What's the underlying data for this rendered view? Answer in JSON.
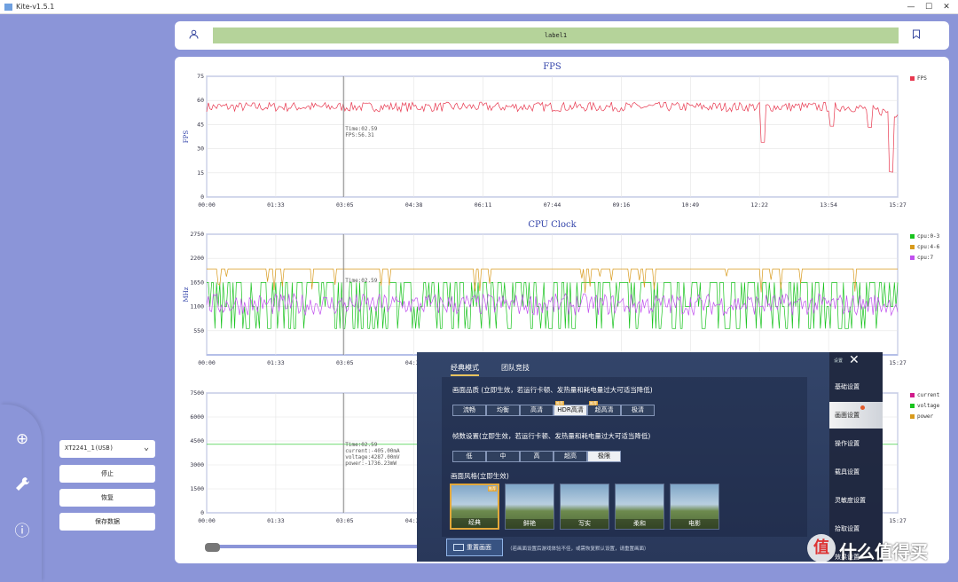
{
  "window": {
    "title": "Kite-v1.5.1",
    "controls": [
      "—",
      "☐",
      "✕"
    ]
  },
  "header": {
    "label": "label1"
  },
  "device": {
    "selected": "XT2241_1(USB)",
    "buttons": [
      "停止",
      "恢复",
      "保存数据"
    ]
  },
  "chart_data": [
    {
      "type": "line",
      "title": "FPS",
      "ylabel": "FPS",
      "yticks": [
        "0",
        "15",
        "30",
        "45",
        "60",
        "75"
      ],
      "ylim": [
        0,
        75
      ],
      "xticks": [
        "00:00",
        "01:33",
        "03:05",
        "04:38",
        "06:11",
        "07:44",
        "09:16",
        "10:49",
        "12:22",
        "13:54",
        "15:27"
      ],
      "series": [
        {
          "name": "FPS",
          "color": "#e8384f",
          "base": 56,
          "noise": 3,
          "dips": [
            [
              0.805,
              34
            ],
            [
              0.99,
              19
            ],
            [
              0.905,
              44
            ],
            [
              0.96,
              45
            ]
          ]
        }
      ],
      "cursor": {
        "time_frac": 0.2,
        "text": [
          "Time:02.59",
          "FPS:56.31"
        ]
      },
      "legend": "right"
    },
    {
      "type": "line",
      "title": "CPU Clock",
      "ylabel": "MHz",
      "yticks": [
        "550",
        "1100",
        "1650",
        "2200",
        "2750"
      ],
      "ylim": [
        0,
        2750
      ],
      "xticks": [
        "00:00",
        "01:33",
        "03:05",
        "04:38",
        "06:11",
        "07:44",
        "09:16",
        "10:49",
        "12:22",
        "13:54",
        "15:27"
      ],
      "series": [
        {
          "name": "cpu:0-3",
          "color": "#19c31e",
          "base": 1100,
          "noise": 500
        },
        {
          "name": "cpu:4-6",
          "color": "#d89a1c",
          "base": 1960,
          "noise": 40
        },
        {
          "name": "cpu:7",
          "color": "#c050ee",
          "base": 1100,
          "noise": 250
        }
      ],
      "cursor": {
        "time_frac": 0.2,
        "text": [
          "Time:02.59"
        ]
      },
      "legend": "right"
    },
    {
      "type": "line",
      "title": "",
      "ylabel": "",
      "yticks": [
        "0",
        "1500",
        "3000",
        "4500",
        "6000",
        "7500"
      ],
      "ylim": [
        0,
        7500
      ],
      "xticks": [
        "00:00",
        "01:33",
        "03:05",
        "04:38",
        "06:11",
        "07:44",
        "09:16",
        "10:49",
        "12:22",
        "13:54",
        "15:27"
      ],
      "series": [
        {
          "name": "current",
          "color": "#d01a8a",
          "base": 0,
          "noise": 0
        },
        {
          "name": "voltage",
          "color": "#19c31e",
          "base": 4287,
          "noise": 0
        },
        {
          "name": "power",
          "color": "#d89a1c",
          "base": 0,
          "noise": 0
        }
      ],
      "cursor": {
        "time_frac": 0.2,
        "text": [
          "Time:02.59",
          "current:-405.00mA",
          "voltage:4287.00mV",
          "power:-1736.23mW"
        ]
      },
      "legend": "right"
    }
  ],
  "game": {
    "tabs": [
      "经典模式",
      "团队竞技"
    ],
    "quality_label": "画面品质 (立即生效，若运行卡顿、发热量和耗电量过大可适当降低)",
    "quality_opts": [
      "流畅",
      "均衡",
      "高清",
      "HDR高清",
      "超高清",
      "极清"
    ],
    "quality_selected": 3,
    "fps_label": "帧数设置(立即生效，若运行卡顿、发热量和耗电量过大可适当降低)",
    "fps_opts": [
      "低",
      "中",
      "高",
      "超高",
      "极限"
    ],
    "fps_selected": 4,
    "style_label": "画面风格(立即生效)",
    "styles": [
      "经典",
      "鲜艳",
      "写实",
      "柔和",
      "电影"
    ],
    "style_selected": 0,
    "tag": "推荐",
    "reset": "重置画面",
    "note": "（若画面设置后游戏体验不佳，或需恢复默认设置，请重置画面）",
    "side_header": "设置",
    "side": [
      "基础设置",
      "画面设置",
      "操作设置",
      "载具设置",
      "灵敏度设置",
      "拾取设置",
      "效果设置"
    ],
    "side_selected": 1
  },
  "watermark": {
    "logo": "值",
    "text": "什么值得买"
  }
}
